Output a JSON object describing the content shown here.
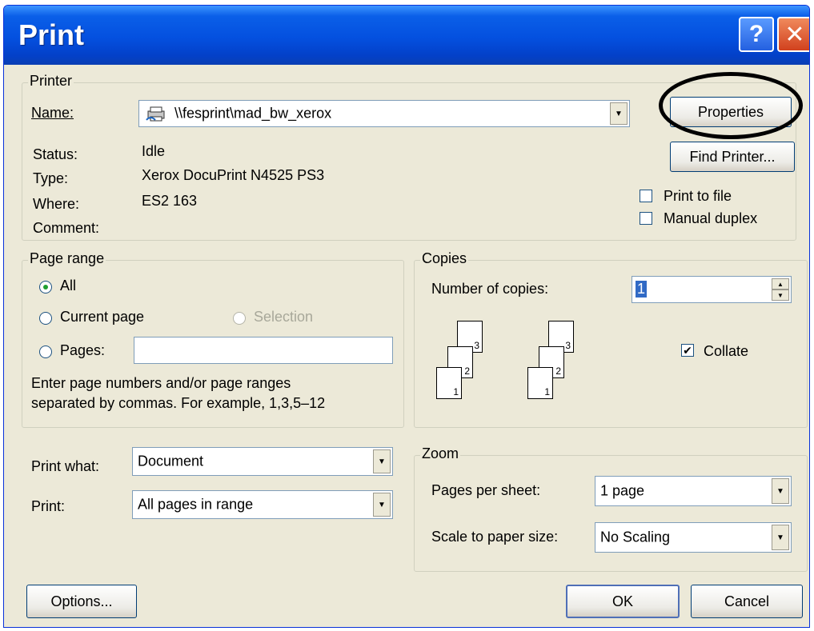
{
  "window": {
    "title": "Print",
    "help_glyph": "?",
    "close_glyph": "✕"
  },
  "printer": {
    "legend": "Printer",
    "name_label": "Name:",
    "name_value": "\\\\fesprint\\mad_bw_xerox",
    "status_label": "Status:",
    "status_value": "Idle",
    "type_label": "Type:",
    "type_value": "Xerox DocuPrint N4525 PS3",
    "where_label": "Where:",
    "where_value": "ES2 163",
    "comment_label": "Comment:",
    "properties_button": "Properties",
    "find_printer_button": "Find Printer...",
    "print_to_file_label": "Print to file",
    "print_to_file_checked": false,
    "manual_duplex_label": "Manual duplex",
    "manual_duplex_checked": false
  },
  "page_range": {
    "legend": "Page range",
    "all_label": "All",
    "current_page_label": "Current page",
    "selection_label": "Selection",
    "pages_label": "Pages:",
    "pages_value": "",
    "selected": "all",
    "help_line1": "Enter page numbers and/or page ranges",
    "help_line2": "separated by commas.  For example, 1,3,5–12"
  },
  "copies": {
    "legend": "Copies",
    "number_label": "Number of copies:",
    "number_value": "1",
    "collate_label": "Collate",
    "collate_checked": true,
    "page_numbers": [
      "1",
      "2",
      "3"
    ]
  },
  "print_what": {
    "label": "Print what:",
    "value": "Document",
    "print_label": "Print:",
    "print_value": "All pages in range"
  },
  "zoom": {
    "legend": "Zoom",
    "pages_per_sheet_label": "Pages per sheet:",
    "pages_per_sheet_value": "1 page",
    "scale_label": "Scale to paper size:",
    "scale_value": "No Scaling"
  },
  "footer": {
    "options_button": "Options...",
    "ok_button": "OK",
    "cancel_button": "Cancel"
  }
}
